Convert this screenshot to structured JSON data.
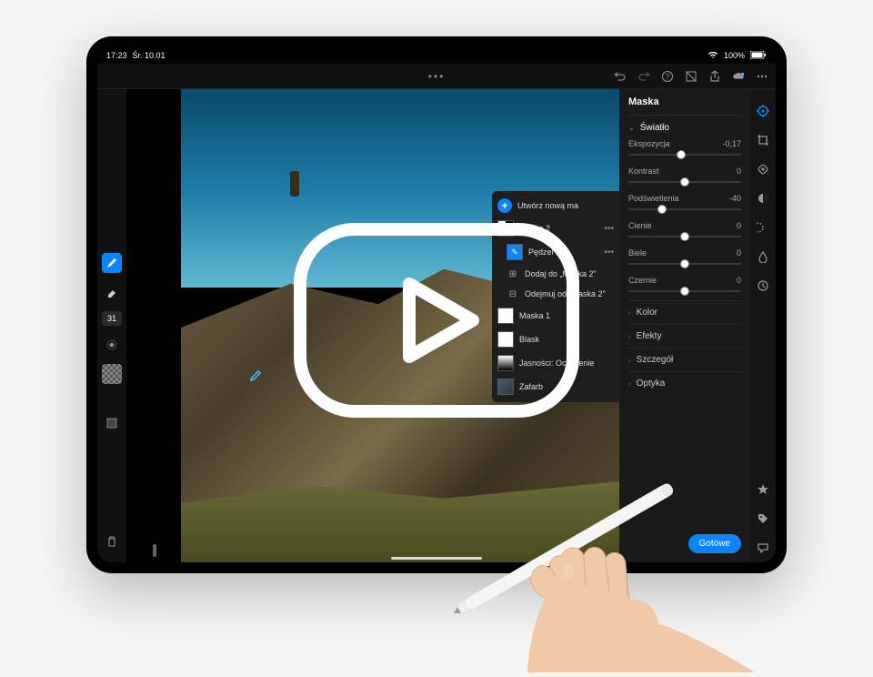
{
  "status": {
    "time": "17:23",
    "date": "Śr. 10.01",
    "battery": "100%"
  },
  "panel": {
    "title": "Maska",
    "light_section": "Światło",
    "done_button": "Gotowe"
  },
  "sliders": {
    "exposure": {
      "label": "Ekspozycja",
      "value": "-0,17",
      "pos": 47
    },
    "contrast": {
      "label": "Kontrast",
      "value": "0",
      "pos": 50
    },
    "highlights": {
      "label": "Podświetlenia",
      "value": "-40",
      "pos": 30
    },
    "shadows": {
      "label": "Cienie",
      "value": "0",
      "pos": 50
    },
    "whites": {
      "label": "Biele",
      "value": "0",
      "pos": 50
    },
    "blacks": {
      "label": "Czernie",
      "value": "0",
      "pos": 50
    }
  },
  "collapsed": {
    "color": "Kolor",
    "effects": "Efekty",
    "detail": "Szczegół",
    "optics": "Optyka"
  },
  "masks": {
    "create": "Utwórz nową ma",
    "mask2": "Maska 2",
    "brush1": "Pędzel 1",
    "add_to": "Dodaj do „Maska 2\"",
    "subtract_from": "Odejmuj od „Maska 2\"",
    "mask1": "Maska 1",
    "glow": "Blask",
    "warmth": "Jasności: Ocieplenie",
    "fill": "Zafarb"
  },
  "left_tools": {
    "brush_size": "31"
  }
}
